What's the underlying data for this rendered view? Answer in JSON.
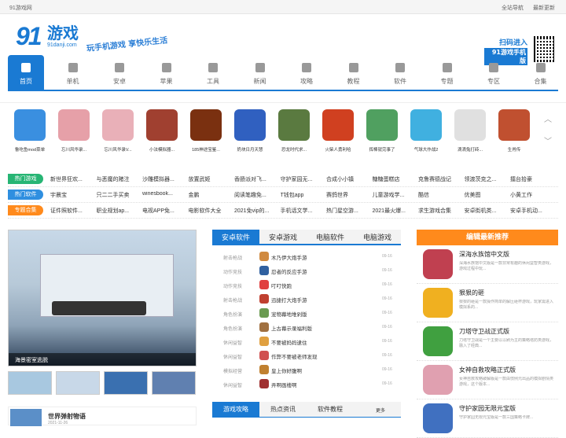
{
  "topbar": {
    "site": "91游戏网",
    "all_nav": "全站导航",
    "latest": "最新更新"
  },
  "header": {
    "logo_num": "91",
    "logo_text": "游戏",
    "logo_domain": "91danji.com",
    "slogan": "玩手机游戏  享快乐生活",
    "scan": "扫码进入",
    "app": "91游戏手机版"
  },
  "nav": [
    "首页",
    "单机",
    "安卓",
    "苹果",
    "工具",
    "新闻",
    "攻略",
    "教程",
    "软件",
    "专题",
    "专区",
    "合集"
  ],
  "games": [
    {
      "name": "鲁吃鱼mod菜单",
      "color": "#3a8fe0"
    },
    {
      "name": "忘川风华录...",
      "color": "#e6a0a8"
    },
    {
      "name": "忘川风华录V...",
      "color": "#e9b0b8"
    },
    {
      "name": "小法模拟器...",
      "color": "#a04030"
    },
    {
      "name": "185神途宝鉴...",
      "color": "#7a3010"
    },
    {
      "name": "奶块日月天慧",
      "color": "#3060c0"
    },
    {
      "name": "恐龙时代求...",
      "color": "#5a7a40"
    },
    {
      "name": "火柴人勇利哈",
      "color": "#d04020"
    },
    {
      "name": "挥棒就完事了",
      "color": "#50a060"
    },
    {
      "name": "气球大作战2",
      "color": "#40b0e0"
    },
    {
      "name": "滴滴兔打砖...",
      "color": "#e0e0e0"
    },
    {
      "name": "生肖传",
      "color": "#c05030"
    }
  ],
  "tags": [
    {
      "label": "热门游戏",
      "color": "#27b574",
      "items": [
        "新世界狂欢...",
        "与恶魔的赌注",
        "沙雕模拟器...",
        "放置武姬",
        "香肠派对飞...",
        "守护家园无...",
        "合成小小镇",
        "糖糖蛋糕店",
        "克鲁赛德战记",
        "领渡茨克之...",
        "擂台拾豪"
      ]
    },
    {
      "label": "热门软件",
      "color": "#2f8fe0",
      "items": [
        "宇晨宝",
        "只二二手买卖",
        "winesbook...",
        "金鹏",
        "阅读笔趣免...",
        "T钱包app",
        "赛鸽世界",
        "儿童游戏学...",
        "酷信",
        "优美图",
        "小黄工作"
      ]
    },
    {
      "label": "专题合集",
      "color": "#ff8a1c",
      "items": [
        "证件照软件...",
        "职业规划ap...",
        "电视APP免...",
        "电影软件大全",
        "2021免vip的...",
        "手机话文学...",
        "热门星空游...",
        "2021最火爆...",
        "求生游戏合集",
        "安卓街机类...",
        "安卓手机动..."
      ]
    }
  ],
  "focus": {
    "caption": "海景密室逃脱",
    "thumbs": [
      "#a8c8e0",
      "#c8d8e8",
      "#3a70b0",
      "#6080b0"
    ]
  },
  "news": {
    "title": "世界弹射物语",
    "date": "2021-11-26"
  },
  "mid": {
    "tabs": [
      "安卓软件",
      "安卓游戏",
      "电脑软件",
      "电脑游戏"
    ],
    "rows": [
      {
        "cat": "射击枪战",
        "title": "木乃伊大炮手游",
        "date": "09-16",
        "color": "#d08a40"
      },
      {
        "cat": "动作竞技",
        "title": "忍者的反应手游",
        "date": "09-16",
        "color": "#3060a0"
      },
      {
        "cat": "动作竞技",
        "title": "叮叮快跑",
        "date": "09-16",
        "color": "#e04040"
      },
      {
        "cat": "射击枪战",
        "title": "迅捷打大炮手游",
        "date": "09-16",
        "color": "#c04030"
      },
      {
        "cat": "角色扮演",
        "title": "宠物幕地堆剁版",
        "date": "09-16",
        "color": "#6a9a50"
      },
      {
        "cat": "角色扮演",
        "title": "上古幕示录福利版",
        "date": "09-16",
        "color": "#a07040"
      },
      {
        "cat": "休闲益智",
        "title": "不要被妈妈逮住",
        "date": "09-16",
        "color": "#e0a040"
      },
      {
        "cat": "休闲益智",
        "title": "作弊不要被老师发现",
        "date": "09-16",
        "color": "#d05050"
      },
      {
        "cat": "模拟经营",
        "title": "皇上你好腹啊",
        "date": "09-16",
        "color": "#c08030"
      },
      {
        "cat": "休闲益智",
        "title": "弄啊画楼啊",
        "date": "09-16",
        "color": "#a03030"
      }
    ],
    "tabs2": [
      "游戏攻略",
      "热点资讯",
      "软件教程"
    ],
    "more": "更多"
  },
  "right": {
    "head": "编辑最新推荐",
    "items": [
      {
        "title": "深海水族馆中文版",
        "desc": "深海水族馆中文版是一款非常有趣的休闲益智类游戏，游戏过程中玩...",
        "color": "#c04050"
      },
      {
        "title": "狠狠的砸",
        "desc": "狠狠的砸是一款操作简单的解压砸杯游戏，玩家需进入模拟系的...",
        "color": "#f0b020"
      },
      {
        "title": "刀塔守卫战正式版",
        "desc": "刀塔守卫战是一个主要以以刷为主的策略塔防类游戏，融入了经典...",
        "color": "#40a040"
      },
      {
        "title": "女神自救攻略正式版",
        "desc": "女神自救攻略破解版是一款由惯例元出品的模拟剧情类游戏，这个版本...",
        "color": "#e0a0b0"
      },
      {
        "title": "守护家园无限元宝版",
        "desc": "守护家园无限元宝版是一款三国策略卡牌...",
        "color": "#4070c0"
      }
    ]
  }
}
